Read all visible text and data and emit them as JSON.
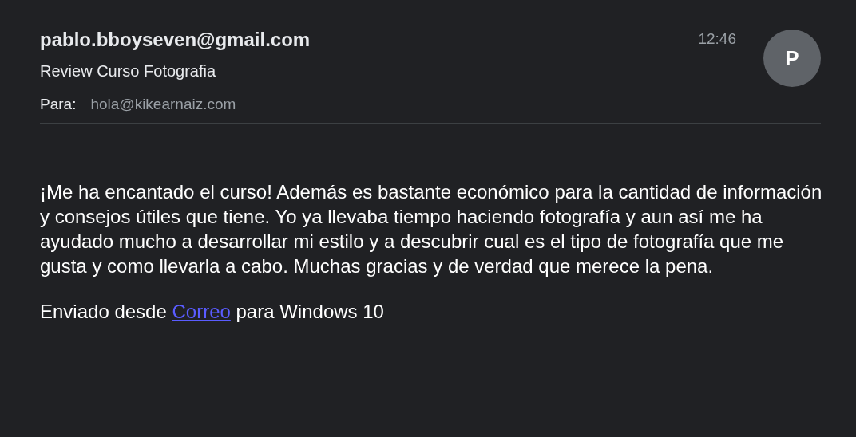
{
  "email": {
    "sender": "pablo.bboyseven@gmail.com",
    "time": "12:46",
    "avatar_letter": "P",
    "subject": "Review Curso Fotografia",
    "to_label": "Para:",
    "to_address": "hola@kikearnaiz.com"
  },
  "body": "¡Me ha encantado el curso! Además es bastante económico para la cantidad de información y consejos útiles que tiene. Yo ya llevaba tiempo haciendo fotografía y aun así me ha ayudado mucho a desarrollar mi estilo y a descubrir cual es el tipo de fotografía que me gusta y como llevarla a cabo. Muchas gracias y de verdad que merece la pena.",
  "signature": {
    "before": "Enviado desde",
    "link": "Correo",
    "after": "para Windows 10"
  }
}
